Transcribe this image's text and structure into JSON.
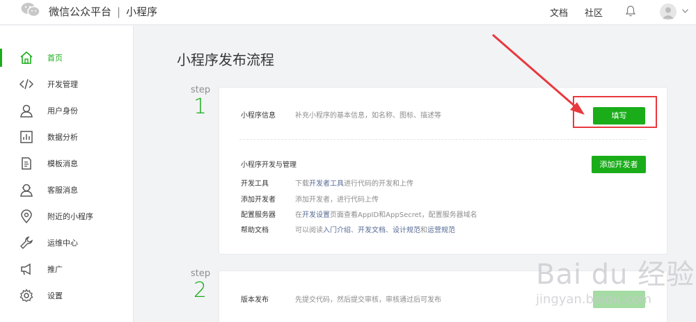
{
  "header": {
    "brand_name": "微信公众平台",
    "separator": "|",
    "section": "小程序",
    "nav": {
      "docs": "文档",
      "community": "社区"
    }
  },
  "sidebar": {
    "items": [
      {
        "label": "首页",
        "icon": "home-icon",
        "active": true
      },
      {
        "label": "开发管理",
        "icon": "code-icon"
      },
      {
        "label": "用户身份",
        "icon": "user-icon"
      },
      {
        "label": "数据分析",
        "icon": "chart-icon"
      },
      {
        "label": "模板消息",
        "icon": "template-icon"
      },
      {
        "label": "客服消息",
        "icon": "service-icon"
      },
      {
        "label": "附近的小程序",
        "icon": "location-icon"
      },
      {
        "label": "运维中心",
        "icon": "wrench-icon"
      },
      {
        "label": "推广",
        "icon": "megaphone-icon"
      },
      {
        "label": "设置",
        "icon": "gear-icon"
      }
    ]
  },
  "main": {
    "title": "小程序发布流程",
    "step1": {
      "step_label": "step",
      "step_number": "1",
      "info_label": "小程序信息",
      "info_desc": "补充小程序的基本信息，如名称、图标、描述等",
      "fill_button": "填写",
      "dev_section_title": "小程序开发与管理",
      "add_dev_button": "添加开发者",
      "rows": [
        {
          "label": "开发工具",
          "pre": "下载",
          "link1": "开发者工具",
          "mid": "进行代码的开发和上传"
        },
        {
          "label": "添加开发者",
          "pre": "添加开发者，进行代码上传"
        },
        {
          "label": "配置服务器",
          "pre": "在",
          "link1": "开发设置",
          "mid": "页面查看AppID和AppSecret，配置服务器域名"
        },
        {
          "label": "帮助文档",
          "pre": "可以阅读",
          "link1": "入门介绍",
          "sep1": "、",
          "link2": "开发文档",
          "sep2": "、",
          "link3": "设计规范",
          "sep3": "和",
          "link4": "运营规范"
        }
      ]
    },
    "step2": {
      "step_label": "step",
      "step_number": "2",
      "publish_label": "版本发布",
      "publish_desc": "先提交代码，然后提交审核，审核通过后可发布"
    }
  },
  "watermark": {
    "brand": "Bai du 经验",
    "url": "jingyan.baidu.com"
  },
  "colors": {
    "accent": "#1aad19",
    "link": "#576b95",
    "annotation": "#e8383d"
  }
}
